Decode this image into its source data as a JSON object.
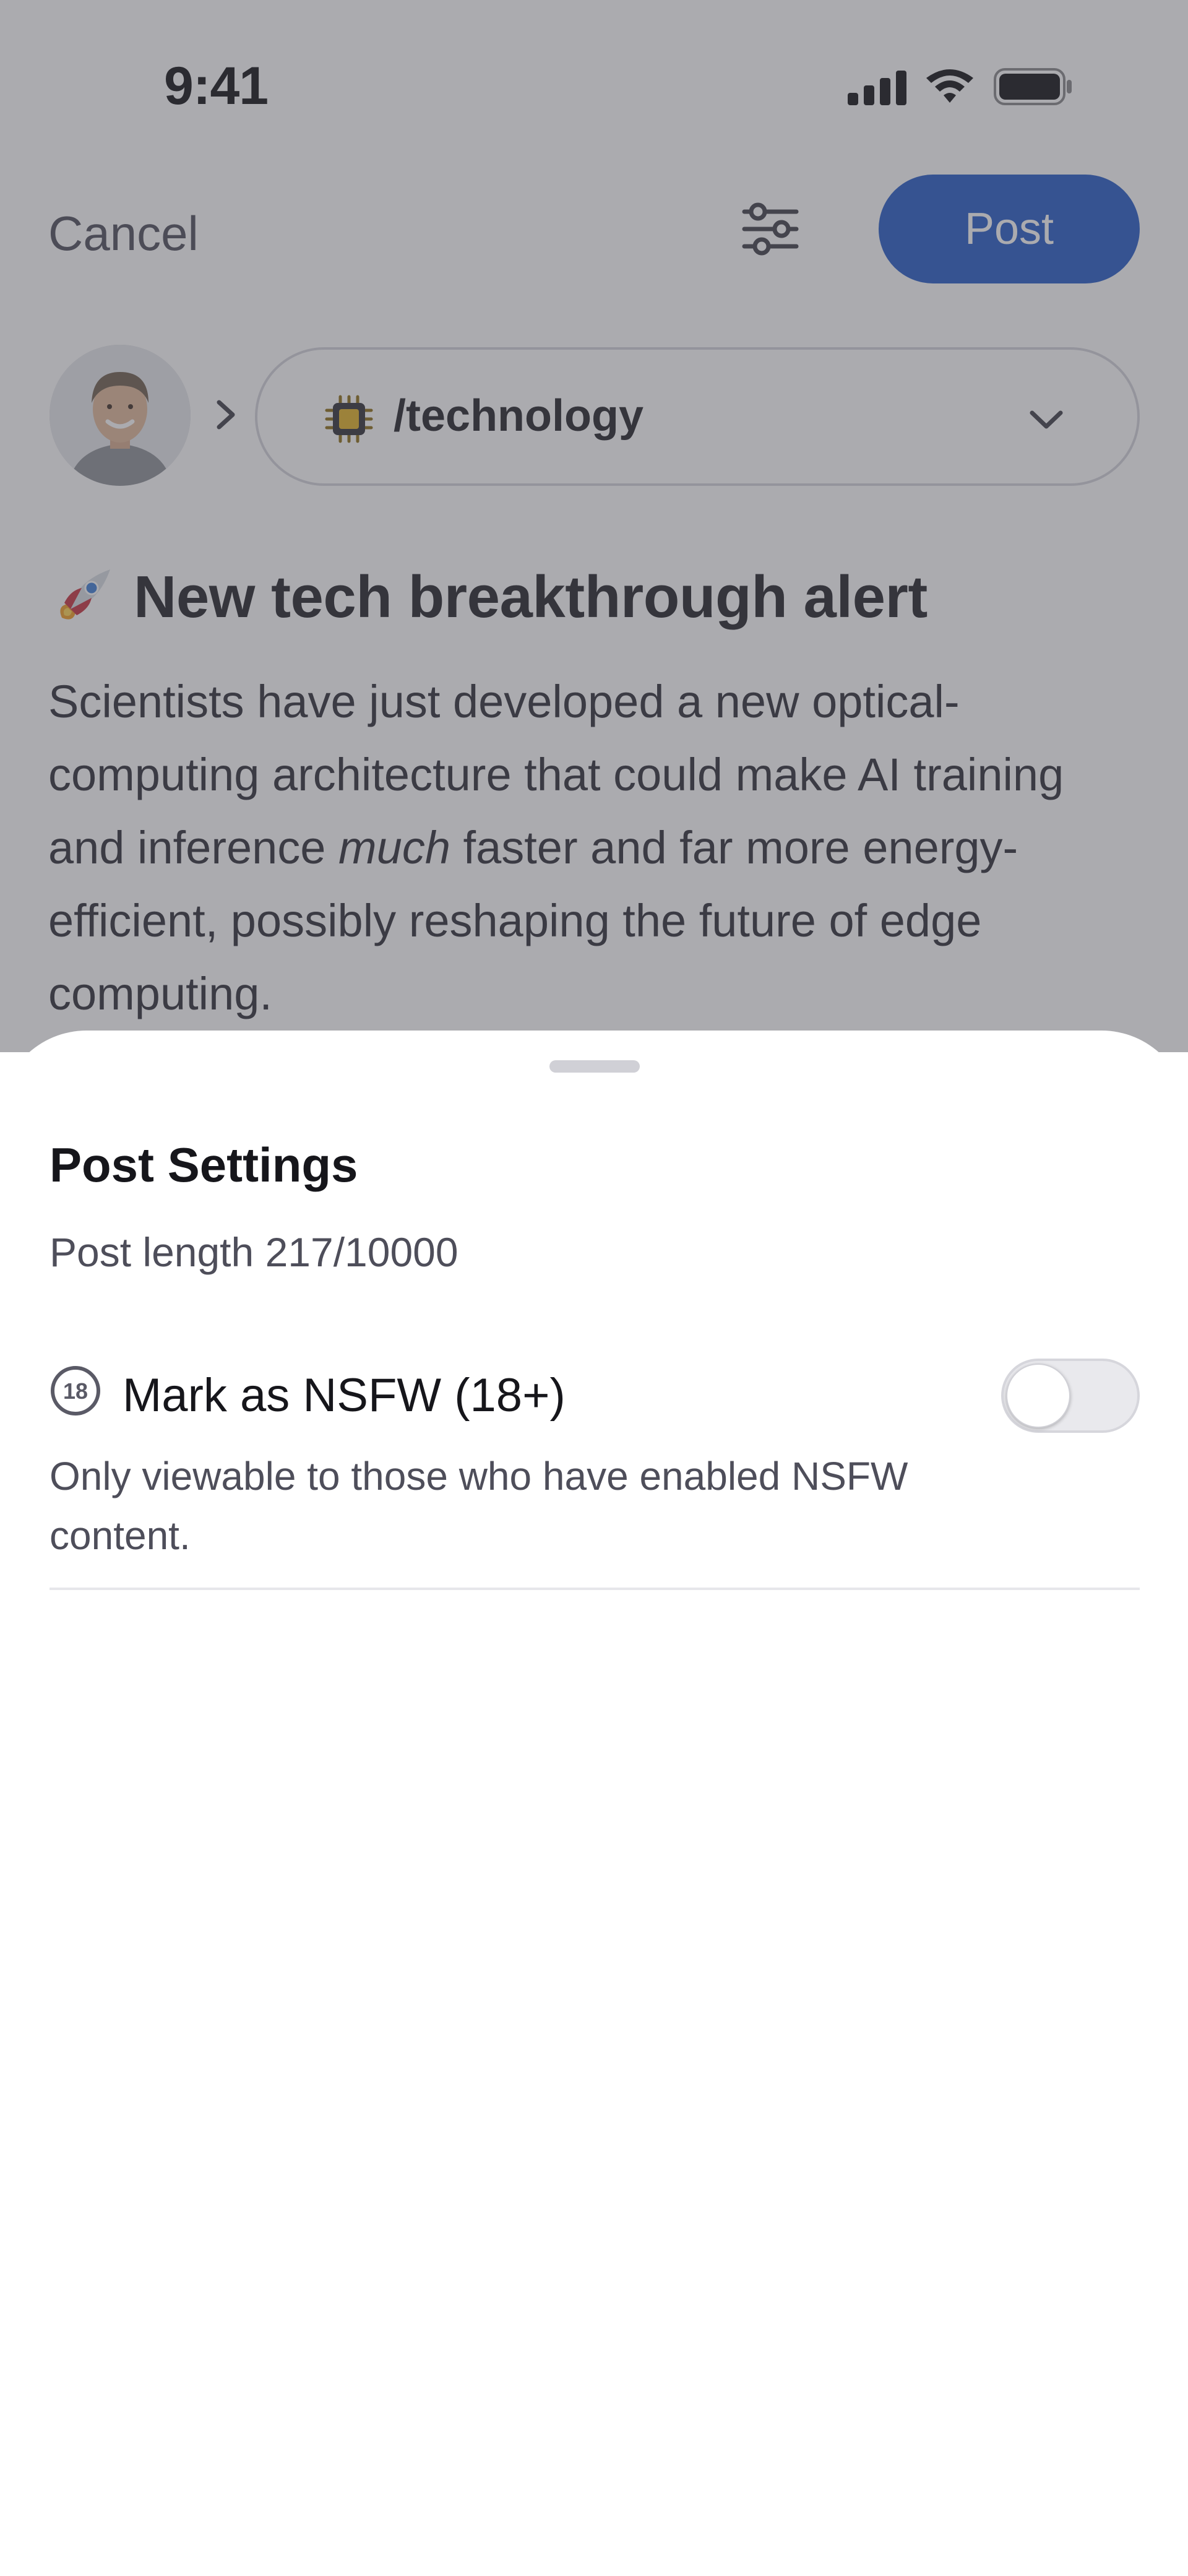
{
  "status_bar": {
    "time": "9:41",
    "icons": [
      "signal-icon",
      "wifi-icon",
      "battery-icon"
    ]
  },
  "toolbar": {
    "cancel_label": "Cancel",
    "settings_icon": "sliders-icon",
    "post_label": "Post"
  },
  "composer": {
    "community": "/technology",
    "community_icon": "chip-icon",
    "title_icon": "rocket-icon",
    "title": "New tech breakthrough alert",
    "body_part1": "Scientists have just developed a new optical-computing architecture that could make AI training and inference ",
    "body_emphasis": "much",
    "body_part2": " faster and far more energy-efficient, possibly reshaping the future of edge computing."
  },
  "settings_sheet": {
    "title": "Post Settings",
    "post_length_label": "Post length",
    "post_length_value": "217/10000",
    "nsfw": {
      "icon": "eighteen-plus-icon",
      "label": "Mark as NSFW (18+)",
      "description": "Only viewable to those who have enabled NSFW content.",
      "enabled": false
    }
  },
  "colors": {
    "accent": "#1f57c5",
    "overlay": "#505058"
  }
}
